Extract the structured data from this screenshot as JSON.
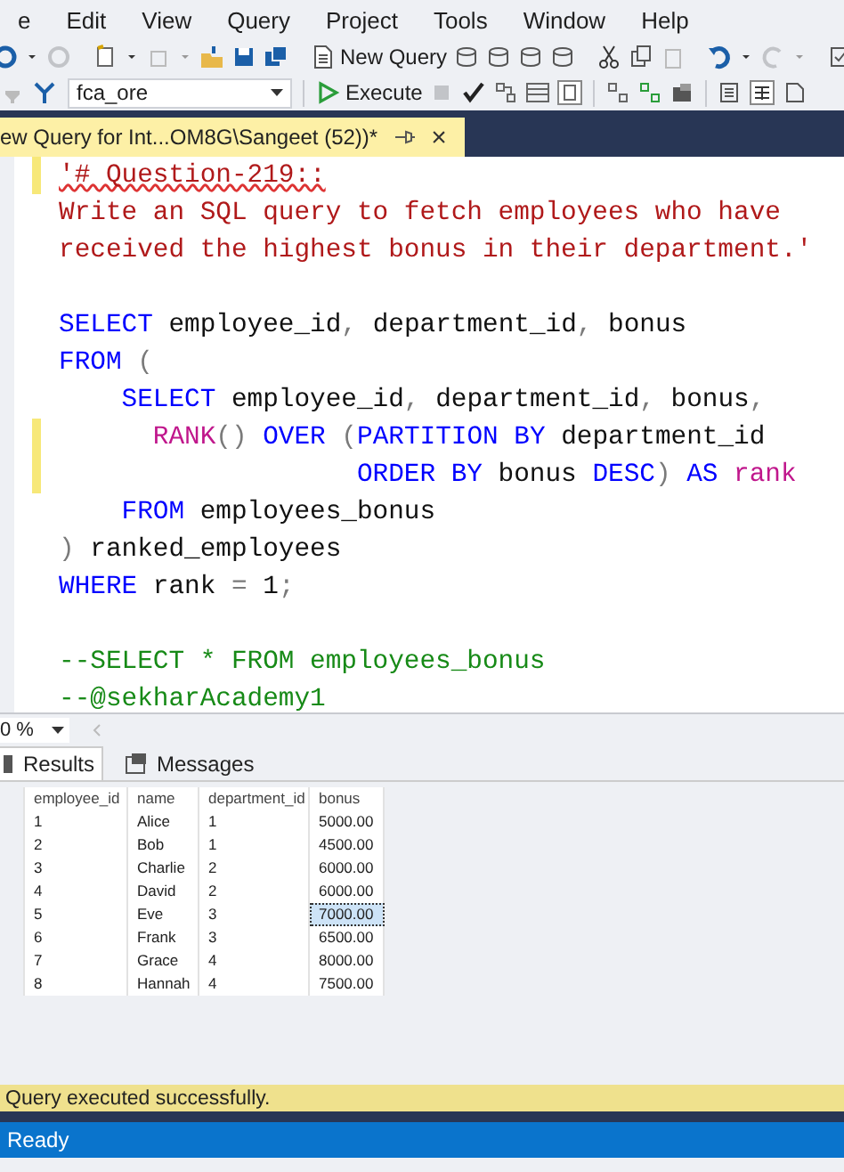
{
  "menu": [
    "e",
    "Edit",
    "View",
    "Query",
    "Project",
    "Tools",
    "Window",
    "Help"
  ],
  "toolbar": {
    "new_query": "New Query",
    "database": "fca_ore",
    "execute": "Execute"
  },
  "document_tab": {
    "title": "ew Query for Int...OM8G\\Sangeet (52))*",
    "close": "×"
  },
  "editor": {
    "lines": [
      {
        "changed": true,
        "tokens": [
          {
            "kind": "string",
            "text": "'# Question-219::",
            "spelling_error": true
          }
        ]
      },
      {
        "changed": false,
        "tokens": [
          {
            "kind": "string",
            "text": "Write an SQL query to fetch employees who have"
          }
        ]
      },
      {
        "changed": false,
        "tokens": [
          {
            "kind": "string",
            "text": "received the highest bonus in their department.'"
          }
        ]
      },
      {
        "changed": false
      },
      {
        "changed": false,
        "tokens": [
          {
            "kind": "keyword",
            "text": "SELECT"
          },
          {
            "kind": "plain",
            "text": " employee_id"
          },
          {
            "kind": "punct",
            "text": ","
          },
          {
            "kind": "plain",
            "text": " department_id"
          },
          {
            "kind": "punct",
            "text": ","
          },
          {
            "kind": "plain",
            "text": " bonus"
          }
        ]
      },
      {
        "changed": false,
        "tokens": [
          {
            "kind": "keyword",
            "text": "FROM"
          },
          {
            "kind": "punct",
            "text": " ("
          }
        ]
      },
      {
        "changed": false,
        "tokens": [
          {
            "kind": "keyword",
            "text": "    SELECT"
          },
          {
            "kind": "plain",
            "text": " employee_id"
          },
          {
            "kind": "punct",
            "text": ","
          },
          {
            "kind": "plain",
            "text": " department_id"
          },
          {
            "kind": "punct",
            "text": ","
          },
          {
            "kind": "plain",
            "text": " bonus"
          },
          {
            "kind": "punct",
            "text": ","
          }
        ]
      },
      {
        "changed": true,
        "tokens": [
          {
            "kind": "function",
            "text": "      RANK"
          },
          {
            "kind": "punct",
            "text": "()"
          },
          {
            "kind": "keyword",
            "text": " OVER"
          },
          {
            "kind": "punct",
            "text": " ("
          },
          {
            "kind": "keyword",
            "text": "PARTITION BY"
          },
          {
            "kind": "plain",
            "text": " department_id"
          }
        ]
      },
      {
        "changed": true,
        "tokens": [
          {
            "kind": "keyword",
            "text": "                   ORDER BY"
          },
          {
            "kind": "plain",
            "text": " bonus "
          },
          {
            "kind": "keyword",
            "text": "DESC"
          },
          {
            "kind": "punct",
            "text": ")"
          },
          {
            "kind": "keyword",
            "text": " AS"
          },
          {
            "kind": "function",
            "text": " rank"
          }
        ]
      },
      {
        "changed": false,
        "tokens": [
          {
            "kind": "keyword",
            "text": "    FROM"
          },
          {
            "kind": "plain",
            "text": " employees_bonus"
          }
        ]
      },
      {
        "changed": false,
        "tokens": [
          {
            "kind": "punct",
            "text": ")"
          },
          {
            "kind": "plain",
            "text": " ranked_employees"
          }
        ]
      },
      {
        "changed": false,
        "tokens": [
          {
            "kind": "keyword",
            "text": "WHERE"
          },
          {
            "kind": "plain",
            "text": " rank "
          },
          {
            "kind": "punct",
            "text": "="
          },
          {
            "kind": "plain",
            "text": " 1"
          },
          {
            "kind": "punct",
            "text": ";"
          }
        ]
      },
      {
        "changed": false
      },
      {
        "changed": false,
        "tokens": [
          {
            "kind": "comment",
            "text": "--SELECT * FROM employees_bonus"
          }
        ]
      },
      {
        "changed": false,
        "tokens": [
          {
            "kind": "comment",
            "text": "--@sekharAcademy1"
          }
        ]
      }
    ]
  },
  "zoom": "0 %",
  "result_tabs": [
    {
      "label": "Results",
      "selected": true
    },
    {
      "label": "Messages",
      "selected": false
    }
  ],
  "grid": {
    "columns": [
      "employee_id",
      "name",
      "department_id",
      "bonus"
    ],
    "rows": [
      {
        "cells": [
          {
            "text": "1",
            "selected": false
          },
          {
            "text": "Alice",
            "selected": false
          },
          {
            "text": "1",
            "selected": false
          },
          {
            "text": "5000.00",
            "selected": false
          }
        ]
      },
      {
        "cells": [
          {
            "text": "2",
            "selected": false
          },
          {
            "text": "Bob",
            "selected": false
          },
          {
            "text": "1",
            "selected": false
          },
          {
            "text": "4500.00",
            "selected": false
          }
        ]
      },
      {
        "cells": [
          {
            "text": "3",
            "selected": false
          },
          {
            "text": "Charlie",
            "selected": false
          },
          {
            "text": "2",
            "selected": false
          },
          {
            "text": "6000.00",
            "selected": false
          }
        ]
      },
      {
        "cells": [
          {
            "text": "4",
            "selected": false
          },
          {
            "text": "David",
            "selected": false
          },
          {
            "text": "2",
            "selected": false
          },
          {
            "text": "6000.00",
            "selected": false
          }
        ]
      },
      {
        "cells": [
          {
            "text": "5",
            "selected": false
          },
          {
            "text": "Eve",
            "selected": false
          },
          {
            "text": "3",
            "selected": false
          },
          {
            "text": "7000.00",
            "selected": true
          }
        ]
      },
      {
        "cells": [
          {
            "text": "6",
            "selected": false
          },
          {
            "text": "Frank",
            "selected": false
          },
          {
            "text": "3",
            "selected": false
          },
          {
            "text": "6500.00",
            "selected": false
          }
        ]
      },
      {
        "cells": [
          {
            "text": "7",
            "selected": false
          },
          {
            "text": "Grace",
            "selected": false
          },
          {
            "text": "4",
            "selected": false
          },
          {
            "text": "8000.00",
            "selected": false
          }
        ]
      },
      {
        "cells": [
          {
            "text": "8",
            "selected": false
          },
          {
            "text": "Hannah",
            "selected": false
          },
          {
            "text": "4",
            "selected": false
          },
          {
            "text": "7500.00",
            "selected": false
          }
        ]
      }
    ]
  },
  "query_status": "Query executed successfully.",
  "status_bar": "Ready"
}
